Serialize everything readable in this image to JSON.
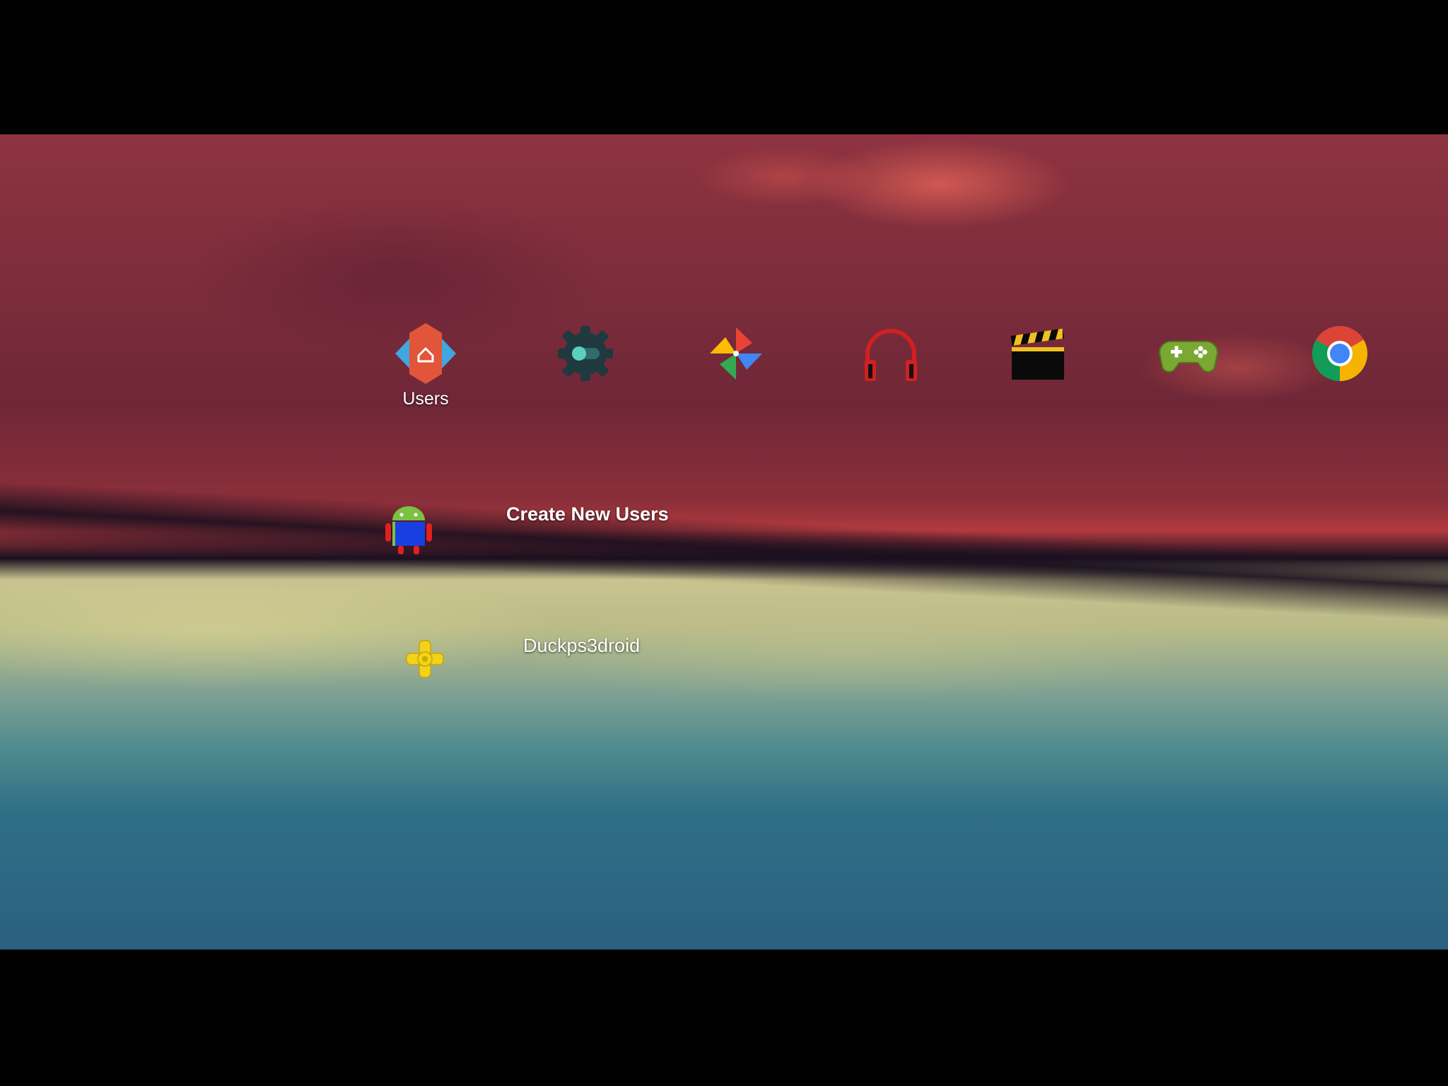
{
  "dock": {
    "apps": [
      {
        "name": "nova-launcher",
        "label": "Users",
        "icon": "nova-launcher-icon"
      },
      {
        "name": "toggle-settings",
        "label": "",
        "icon": "gear-toggle-icon"
      },
      {
        "name": "photos",
        "label": "",
        "icon": "pinwheel-icon"
      },
      {
        "name": "music",
        "label": "",
        "icon": "headphones-icon"
      },
      {
        "name": "video",
        "label": "",
        "icon": "clapperboard-icon"
      },
      {
        "name": "games",
        "label": "",
        "icon": "gamepad-icon"
      },
      {
        "name": "chrome",
        "label": "",
        "icon": "chrome-icon"
      }
    ]
  },
  "rows": [
    {
      "label": "Create New Users",
      "icon": "android-robot-icon"
    },
    {
      "label": "Duckps3droid",
      "icon": "ppsspp-icon"
    }
  ],
  "colors": {
    "sky_red": "#8e3340",
    "sand": "#c9c48f",
    "sea": "#2f6f86"
  }
}
